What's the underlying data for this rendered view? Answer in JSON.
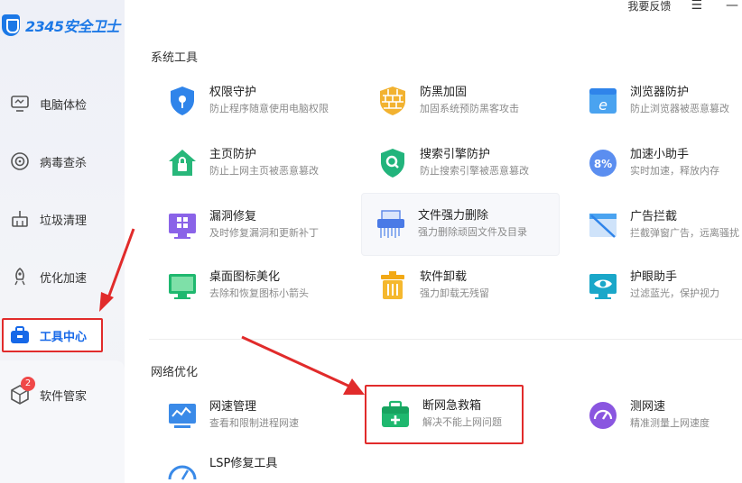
{
  "app": {
    "logo_text": "2345安全卫士"
  },
  "top_actions": {
    "feedback": "我要反馈",
    "menu": "☰",
    "minimize": "—"
  },
  "sidebar": {
    "items": [
      {
        "label": "电脑体检",
        "icon": "monitor-icon"
      },
      {
        "label": "病毒查杀",
        "icon": "target-icon"
      },
      {
        "label": "垃圾清理",
        "icon": "broom-icon"
      },
      {
        "label": "优化加速",
        "icon": "rocket-icon"
      },
      {
        "label": "工具中心",
        "icon": "toolbox-icon",
        "active": true
      },
      {
        "label": "软件管家",
        "icon": "box-icon",
        "badge": "2"
      }
    ]
  },
  "sections": {
    "system_tools": {
      "title": "系统工具",
      "tools": [
        {
          "name": "权限守护",
          "desc": "防止程序随意使用电脑权限"
        },
        {
          "name": "防黑加固",
          "desc": "加固系统预防黑客攻击"
        },
        {
          "name": "浏览器防护",
          "desc": "防止浏览器被恶意篡改"
        },
        {
          "name": "主页防护",
          "desc": "防止上网主页被恶意篡改"
        },
        {
          "name": "搜索引擎防护",
          "desc": "防止搜索引擎被恶意篡改"
        },
        {
          "name": "加速小助手",
          "desc": "实时加速，释放内存"
        },
        {
          "name": "漏洞修复",
          "desc": "及时修复漏洞和更新补丁"
        },
        {
          "name": "文件强力删除",
          "desc": "强力删除顽固文件及目录"
        },
        {
          "name": "广告拦截",
          "desc": "拦截弹窗广告，远离骚扰"
        },
        {
          "name": "桌面图标美化",
          "desc": "去除和恢复图标小箭头"
        },
        {
          "name": "软件卸载",
          "desc": "强力卸载无残留"
        },
        {
          "name": "护眼助手",
          "desc": "过滤蓝光，保护视力"
        }
      ]
    },
    "network": {
      "title": "网络优化",
      "tools": [
        {
          "name": "网速管理",
          "desc": "查看和限制进程网速"
        },
        {
          "name": "断网急救箱",
          "desc": "解决不能上网问题"
        },
        {
          "name": "测网速",
          "desc": "精准测量上网速度"
        },
        {
          "name": "LSP修复工具",
          "desc": ""
        }
      ]
    }
  },
  "colors": {
    "accent": "#1668e8",
    "highlight_red": "#e12b2b"
  }
}
